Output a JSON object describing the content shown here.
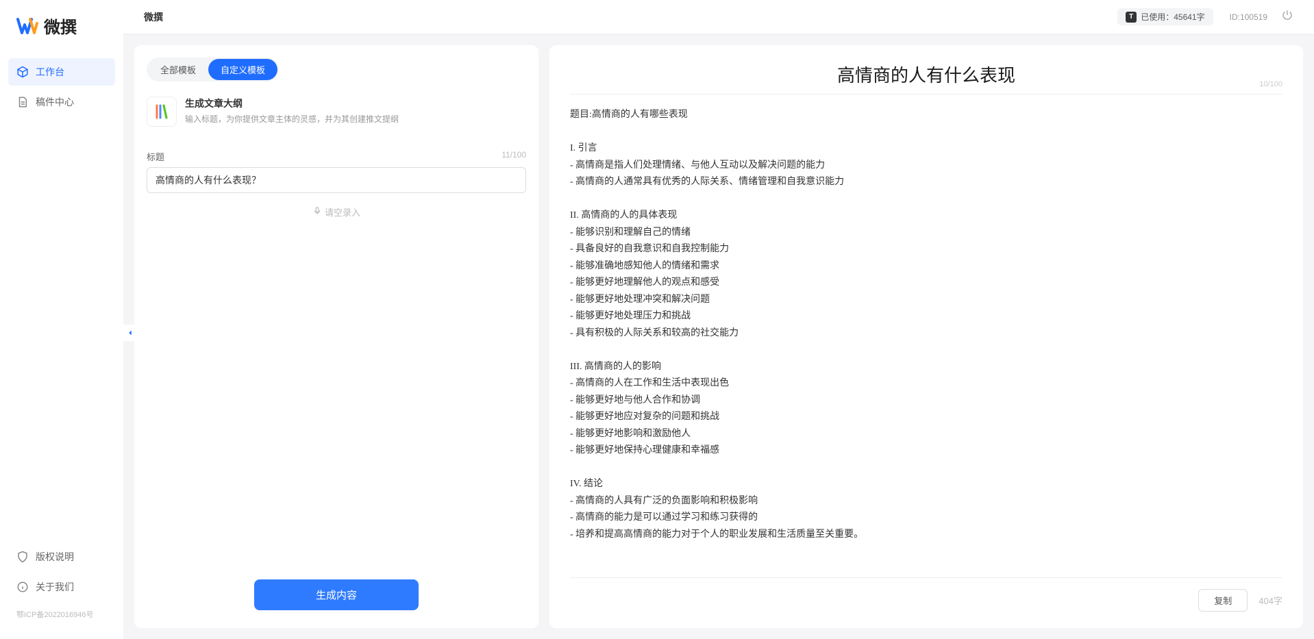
{
  "app": {
    "name": "微撰",
    "logo_text": "微撰"
  },
  "topbar": {
    "usage_label": "已使用：",
    "usage_value": "45641字",
    "id_label": "ID:100519"
  },
  "sidebar": {
    "items": [
      {
        "label": "工作台",
        "active": true
      },
      {
        "label": "稿件中心",
        "active": false
      }
    ],
    "footer": [
      {
        "label": "版权说明"
      },
      {
        "label": "关于我们"
      }
    ],
    "icp": "鄂ICP备2022016946号"
  },
  "tabs": {
    "all": "全部模板",
    "custom": "自定义模板"
  },
  "template": {
    "title": "生成文章大纲",
    "desc": "输入标题，为你提供文章主体的灵感，并为其创建推文提纲"
  },
  "title_field": {
    "label": "标题",
    "counter": "11/100",
    "value": "高情商的人有什么表现？"
  },
  "voice_input_label": "请空录入",
  "generate_btn": "生成内容",
  "output": {
    "heading": "高情商的人有什么表现",
    "heading_counter": "10/100",
    "body": "题目:高情商的人有哪些表现\n\nI. 引言\n- 高情商是指人们处理情绪、与他人互动以及解决问题的能力\n- 高情商的人通常具有优秀的人际关系、情绪管理和自我意识能力\n\nII. 高情商的人的具体表现\n- 能够识别和理解自己的情绪\n- 具备良好的自我意识和自我控制能力\n- 能够准确地感知他人的情绪和需求\n- 能够更好地理解他人的观点和感受\n- 能够更好地处理冲突和解决问题\n- 能够更好地处理压力和挑战\n- 具有积极的人际关系和较高的社交能力\n\nIII. 高情商的人的影响\n- 高情商的人在工作和生活中表现出色\n- 能够更好地与他人合作和协调\n- 能够更好地应对复杂的问题和挑战\n- 能够更好地影响和激励他人\n- 能够更好地保持心理健康和幸福感\n\nIV. 结论\n- 高情商的人具有广泛的负面影响和积极影响\n- 高情商的能力是可以通过学习和练习获得的\n- 培养和提高高情商的能力对于个人的职业发展和生活质量至关重要。",
    "copy_btn": "复制",
    "word_count": "404字"
  }
}
